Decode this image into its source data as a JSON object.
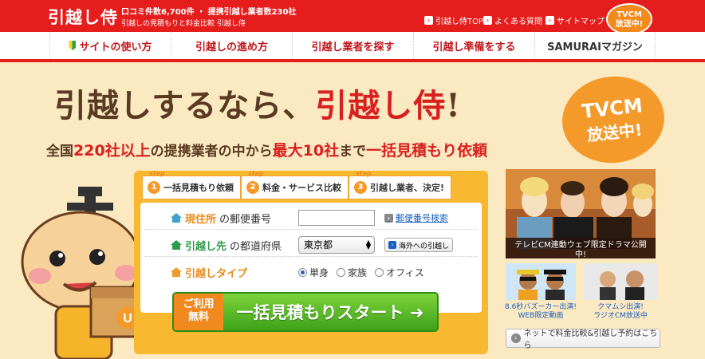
{
  "header": {
    "logo": "引越し侍",
    "tagline_1": "口コミ件数6,700件 ・ 提携引越し業者数230社",
    "tagline_2": "引越しの見積もりと料金比較 引越し侍",
    "links": [
      "引越し侍TOP",
      "よくある質問",
      "サイトマップ"
    ],
    "tv_badge_1": "TVCM",
    "tv_badge_2": "放送中!"
  },
  "nav": {
    "items": [
      "サイトの使い方",
      "引越しの進め方",
      "引越し業者を探す",
      "引越し準備をする",
      "SAMURAIマガジン"
    ]
  },
  "hero": {
    "headline_pre": "引越しするなら、",
    "headline_red": "引越し侍",
    "headline_post": "!",
    "sub_1": "全国",
    "sub_2": "220社以上",
    "sub_3": "の提携業者の中から",
    "sub_4": "最大10社",
    "sub_5": "まで",
    "sub_6": "一括見積もり依頼",
    "tv_1": "TVCM",
    "tv_2": "放送中!"
  },
  "steps": [
    {
      "tag": "step",
      "num": "1",
      "label": "一括見積もり依頼"
    },
    {
      "tag": "step",
      "num": "2",
      "label": "料金・サービス比較"
    },
    {
      "tag": "step",
      "num": "3",
      "label": "引越し業者、決定!"
    }
  ],
  "form": {
    "current_a": "現住所",
    "current_b": "の郵便番号",
    "zip_value": "",
    "zip_link": "郵便番号検索",
    "dest_a": "引越し先",
    "dest_b": "の都道府県",
    "pref_selected": "東京都",
    "abroad_label": "海外への引越し",
    "type_a": "引越しタイプ",
    "types": [
      "単身",
      "家族",
      "オフィス"
    ],
    "type_selected": "単身",
    "free_1": "ご利用",
    "free_2": "無料",
    "start_label": "一括見積もりスタート"
  },
  "side": {
    "video_caption_1": "テレビCM連動ウェブ限定ドラマ公開",
    "video_caption_2": "中!",
    "thumb1_cap_1": "8.6秒バズーカー出演!",
    "thumb1_cap_2": "WEB限定動画",
    "thumb2_cap_1": "クマムシ出演!",
    "thumb2_cap_2": "ラジオCM放送中",
    "net_label": "ネットで料金比較&引越し予約はこちら"
  },
  "colors": {
    "brand_red": "#e51d1d",
    "accent_orange": "#f39a2a",
    "cta_green": "#3ea21a",
    "background": "#fbe9c2"
  }
}
